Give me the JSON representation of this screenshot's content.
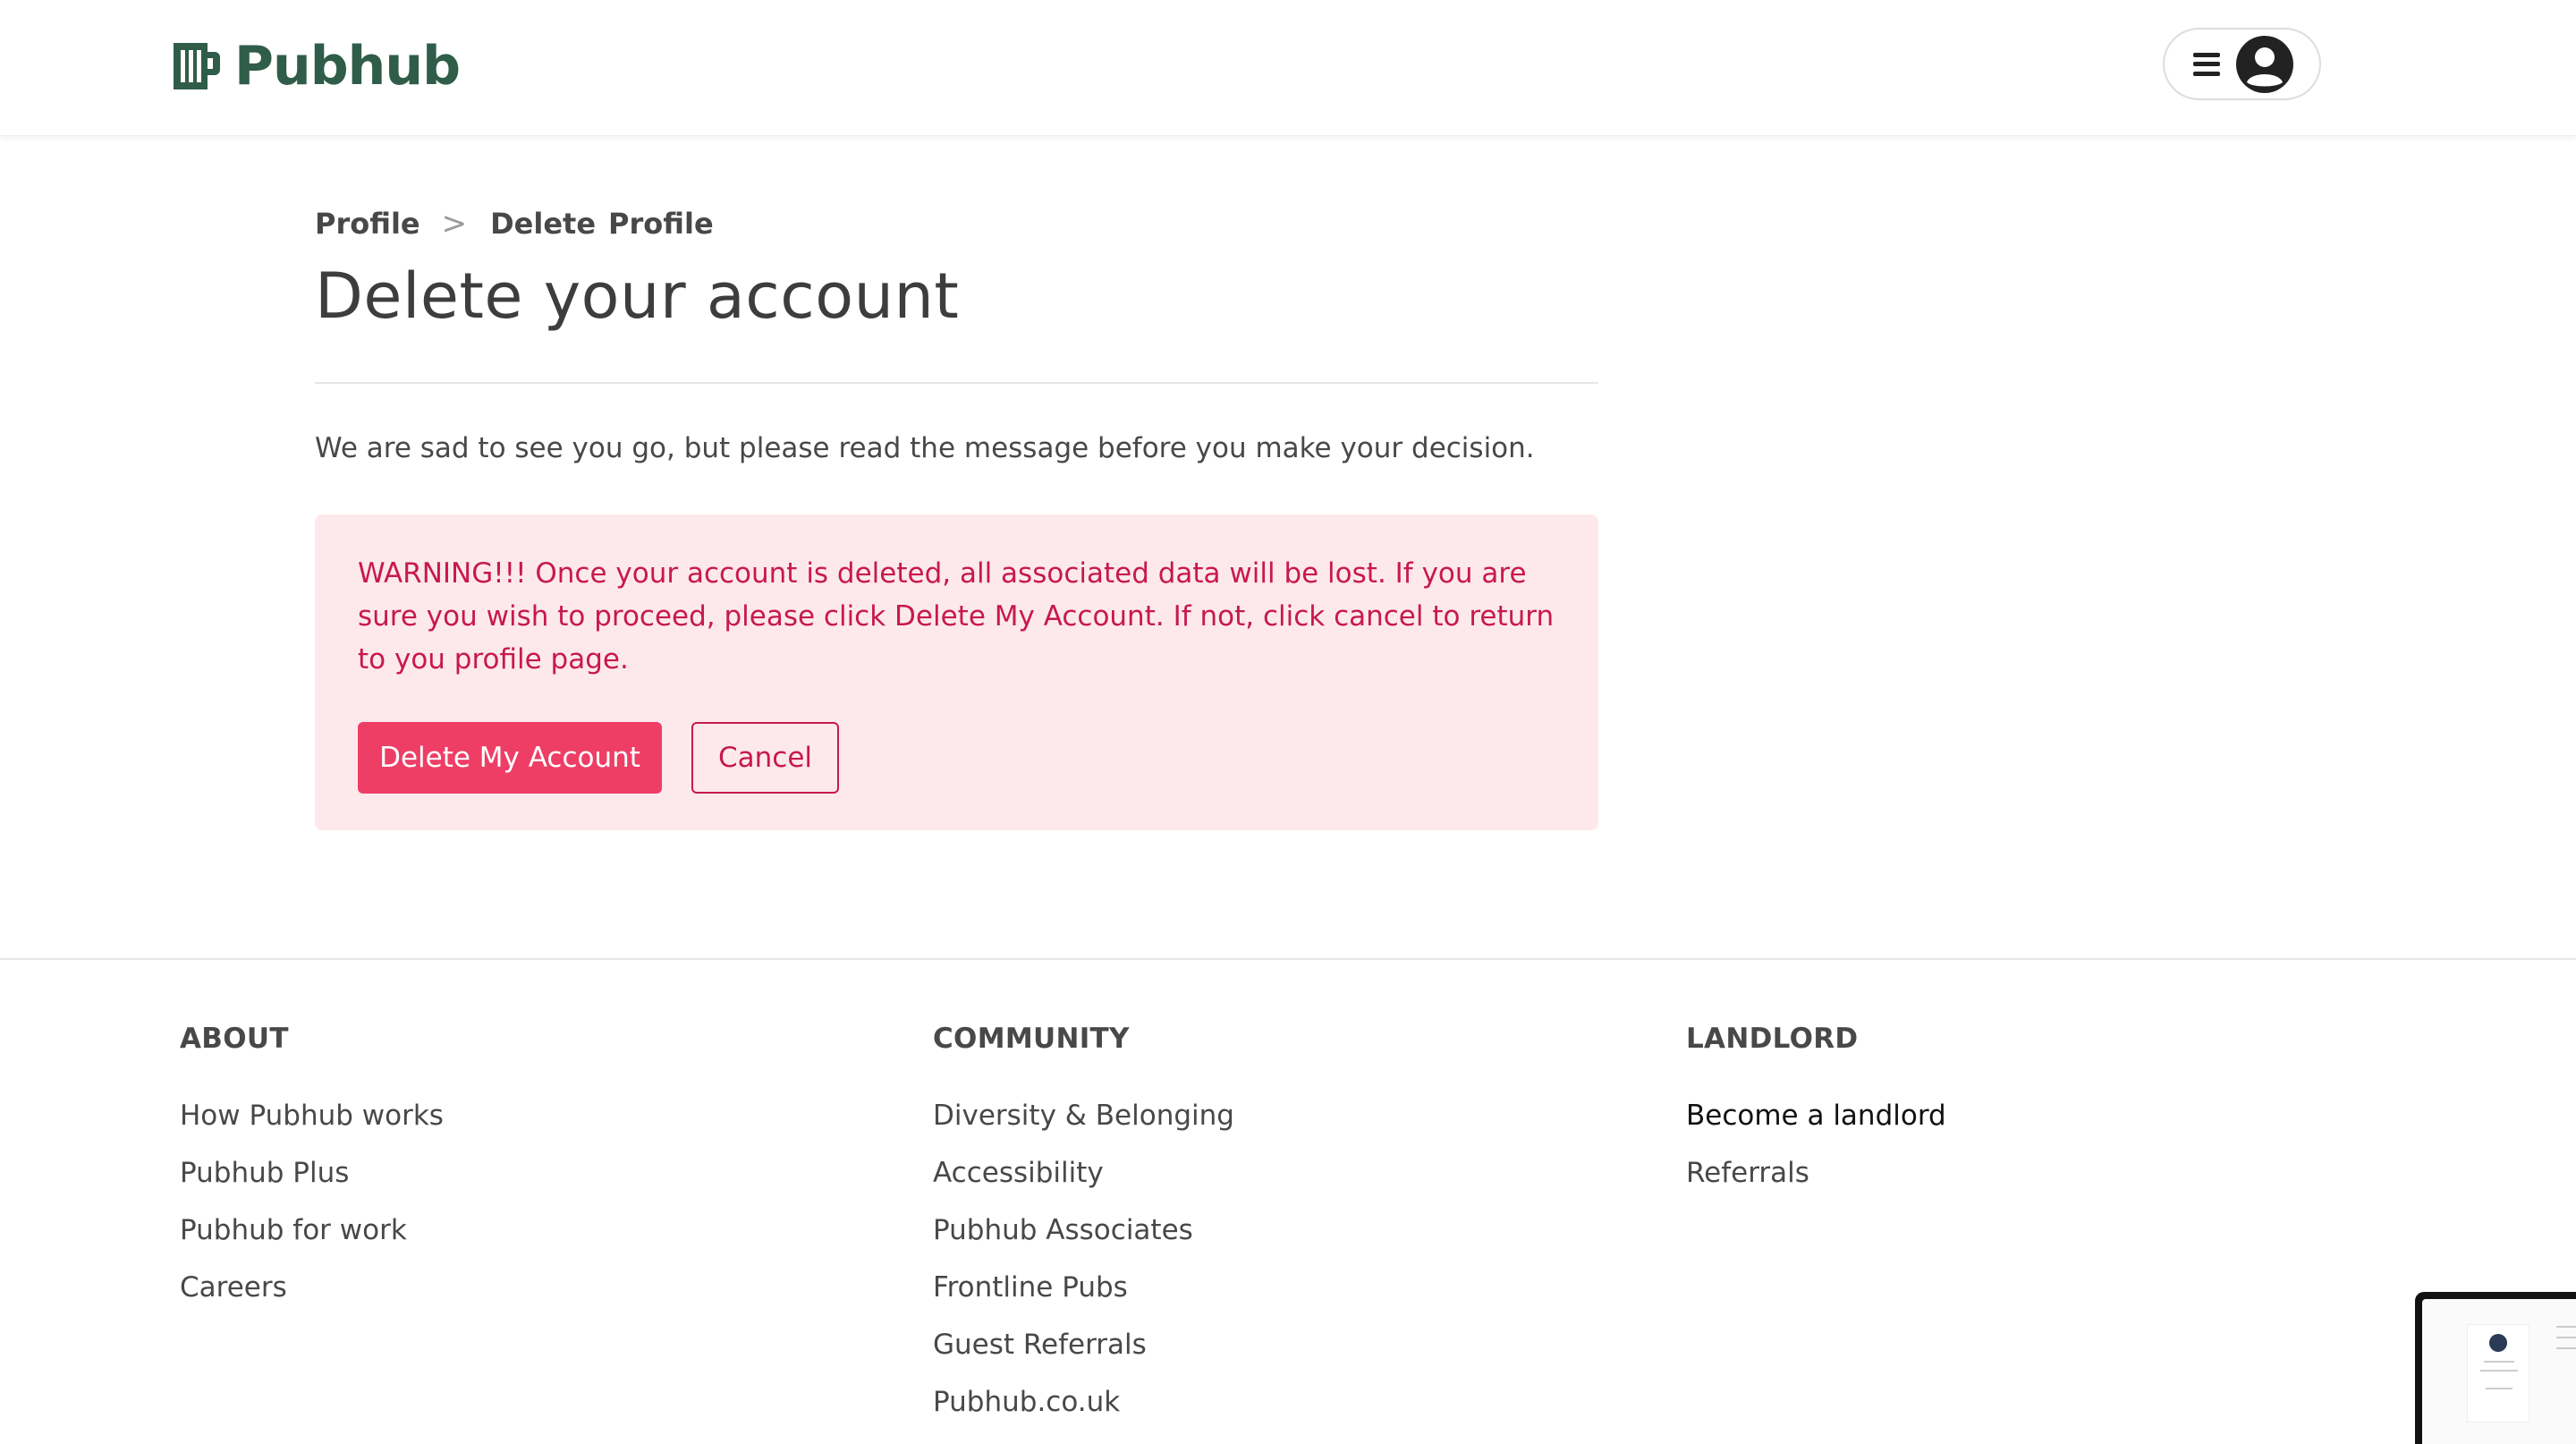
{
  "header": {
    "logo_text": "Pubhub",
    "menu_icon": "hamburger-icon",
    "avatar_icon": "user-avatar-icon"
  },
  "breadcrumb": {
    "parent": "Profile",
    "separator": ">",
    "current_1": "Delete",
    "current_2": "Profile"
  },
  "page": {
    "title": "Delete your account",
    "intro": "We are sad to see you go, but please read the message before you make your decision."
  },
  "warning": {
    "text": "WARNING!!! Once your account is deleted, all associated data will be lost. If you are sure you wish to proceed, please click Delete My Account. If not, click cancel to return to you profile page.",
    "delete_label": "Delete My Account",
    "cancel_label": "Cancel"
  },
  "footer": {
    "about": {
      "heading": "ABOUT",
      "links": [
        "How Pubhub works",
        "Pubhub Plus",
        "Pubhub for work",
        "Careers"
      ]
    },
    "community": {
      "heading": "COMMUNITY",
      "links": [
        "Diversity & Belonging",
        "Accessibility",
        "Pubhub Associates",
        "Frontline Pubs",
        "Guest Referrals",
        "Pubhub.co.uk"
      ]
    },
    "landlord": {
      "heading": "LANDLORD",
      "links": [
        "Become a landlord",
        "Referrals"
      ]
    }
  },
  "colors": {
    "brand": "#2f5d4a",
    "danger": "#ee3e66",
    "danger_text": "#c8194b",
    "warning_bg": "#fde9ec"
  }
}
